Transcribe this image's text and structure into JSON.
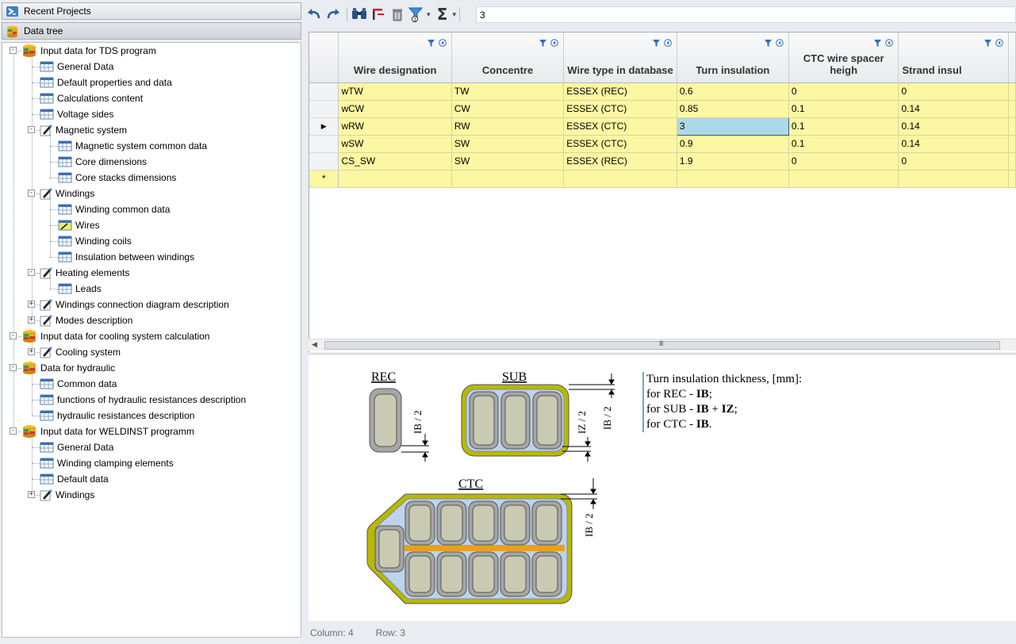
{
  "left_panel": {
    "recent_projects": "Recent Projects",
    "data_tree": "Data tree",
    "tree": [
      {
        "label": "Input data for TDS program",
        "level": 0,
        "icon": "database-icon",
        "expander": "-"
      },
      {
        "label": "General Data",
        "level": 1,
        "icon": "table-icon"
      },
      {
        "label": "Default properties and data",
        "level": 1,
        "icon": "table-icon"
      },
      {
        "label": "Calculations content",
        "level": 1,
        "icon": "table-icon"
      },
      {
        "label": "Voltage sides",
        "level": 1,
        "icon": "table-icon"
      },
      {
        "label": "Magnetic system",
        "level": 1,
        "icon": "edit-icon",
        "expander": "-"
      },
      {
        "label": "Magnetic system common data",
        "level": 2,
        "icon": "table-icon"
      },
      {
        "label": "Core dimensions",
        "level": 2,
        "icon": "table-icon"
      },
      {
        "label": "Core stacks dimensions",
        "level": 2,
        "icon": "table-icon"
      },
      {
        "label": "Windings",
        "level": 1,
        "icon": "edit-icon",
        "expander": "-"
      },
      {
        "label": "Winding common data",
        "level": 2,
        "icon": "table-icon"
      },
      {
        "label": "Wires",
        "level": 2,
        "icon": "table-edit-icon"
      },
      {
        "label": "Winding coils",
        "level": 2,
        "icon": "table-icon"
      },
      {
        "label": "Insulation between windings",
        "level": 2,
        "icon": "table-icon"
      },
      {
        "label": "Heating elements",
        "level": 1,
        "icon": "edit-icon",
        "expander": "-"
      },
      {
        "label": "Leads",
        "level": 2,
        "icon": "table-icon"
      },
      {
        "label": "Windings connection diagram description",
        "level": 1,
        "icon": "edit-icon",
        "expander": "+"
      },
      {
        "label": "Modes description",
        "level": 1,
        "icon": "edit-icon",
        "expander": "+"
      },
      {
        "label": "Input data for cooling system calculation",
        "level": 0,
        "icon": "database-icon",
        "expander": "-"
      },
      {
        "label": "Cooling system",
        "level": 1,
        "icon": "edit-icon",
        "expander": "+"
      },
      {
        "label": "Data for hydraulic",
        "level": 0,
        "icon": "database-icon",
        "expander": "-"
      },
      {
        "label": "Common data",
        "level": 1,
        "icon": "table-icon"
      },
      {
        "label": "functions of hydraulic resistances description",
        "level": 1,
        "icon": "table-icon"
      },
      {
        "label": "hydraulic resistances description",
        "level": 1,
        "icon": "table-icon"
      },
      {
        "label": "Input data for WELDINST programm",
        "level": 0,
        "icon": "database-icon",
        "expander": "-"
      },
      {
        "label": "General Data",
        "level": 1,
        "icon": "table-icon"
      },
      {
        "label": "Winding clamping elements",
        "level": 1,
        "icon": "table-icon"
      },
      {
        "label": "Default data",
        "level": 1,
        "icon": "table-icon"
      },
      {
        "label": "Windings",
        "level": 1,
        "icon": "edit-icon",
        "expander": "+"
      }
    ]
  },
  "toolbar": {
    "cell_value": "3",
    "icons": [
      "undo-icon",
      "redo-icon",
      "binoculars-icon",
      "filter-clear-icon",
      "trash-icon",
      "filter-icon",
      "sum-icon"
    ]
  },
  "grid": {
    "columns": [
      "Wire designation",
      "Concentre",
      "Wire type in database",
      "Turn insulation",
      "CTC wire spacer heigh",
      "Strand insul"
    ],
    "rows": [
      [
        "wTW",
        "TW",
        "ESSEX (REC)",
        "0.6",
        "0",
        "0"
      ],
      [
        "wCW",
        "CW",
        "ESSEX (CTC)",
        "0.85",
        "0.1",
        "0.14"
      ],
      [
        "wRW",
        "RW",
        "ESSEX (CTC)",
        "3",
        "0.1",
        "0.14"
      ],
      [
        "wSW",
        "SW",
        "ESSEX (CTC)",
        "0.9",
        "0.1",
        "0.14"
      ],
      [
        "CS_SW",
        "SW",
        "ESSEX (REC)",
        "1.9",
        "0",
        "0"
      ]
    ],
    "current_row": 2,
    "current_col": 3,
    "new_row_marker": "*",
    "current_marker": "▶"
  },
  "diagram": {
    "rec_label": "REC",
    "sub_label": "SUB",
    "ctc_label": "CTC",
    "dim_ib": "IB / 2",
    "dim_iz": "IZ / 2",
    "desc_title": "Turn insulation thickness, [mm]:",
    "desc_rec_prefix": "for REC - ",
    "desc_rec_value": "IB",
    "desc_rec_suffix": ";",
    "desc_sub_prefix": "for SUB - ",
    "desc_sub_value1": "IB",
    "desc_sub_plus": " + ",
    "desc_sub_value2": "IZ",
    "desc_sub_suffix": ";",
    "desc_ctc_prefix": "for CTC - ",
    "desc_ctc_value": "IB",
    "desc_ctc_suffix": "."
  },
  "status": {
    "column": "Column: 4",
    "row": "Row: 3"
  }
}
